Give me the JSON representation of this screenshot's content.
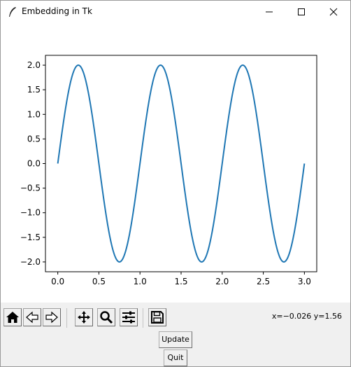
{
  "window": {
    "title": "Embedding in Tk"
  },
  "toolbar": {
    "buttons": [
      {
        "name": "home-button",
        "icon": "home-icon"
      },
      {
        "name": "back-button",
        "icon": "back-arrow-icon"
      },
      {
        "name": "forward-button",
        "icon": "forward-arrow-icon"
      },
      {
        "name": "pan-button",
        "icon": "move-icon"
      },
      {
        "name": "zoom-button",
        "icon": "magnifier-icon"
      },
      {
        "name": "subplots-button",
        "icon": "sliders-icon"
      },
      {
        "name": "save-button",
        "icon": "floppy-disk-icon"
      }
    ],
    "coords": "x=−0.026 y=1.56"
  },
  "buttons": {
    "update_label": "Update",
    "quit_label": "Quit"
  },
  "colors": {
    "line": "#1f77b4",
    "toolbar_bg": "#f0f0f0"
  },
  "chart_data": {
    "type": "line",
    "function": "y = 2*sin(2*pi*t)",
    "x_range": [
      0.0,
      3.0
    ],
    "series": [
      {
        "x": [
          0.0,
          0.1,
          0.2,
          0.25,
          0.3,
          0.4,
          0.5,
          0.6,
          0.7,
          0.75,
          0.8,
          0.9,
          1.0,
          1.1,
          1.2,
          1.25,
          1.3,
          1.4,
          1.5,
          1.6,
          1.7,
          1.75,
          1.8,
          1.9,
          2.0,
          2.1,
          2.2,
          2.25,
          2.3,
          2.4,
          2.5,
          2.6,
          2.7,
          2.75,
          2.8,
          2.9,
          3.0
        ],
        "y": [
          0.0,
          1.18,
          1.9,
          2.0,
          1.9,
          1.18,
          0.0,
          -1.18,
          -1.9,
          -2.0,
          -1.9,
          -1.18,
          0.0,
          1.18,
          1.9,
          2.0,
          1.9,
          1.18,
          0.0,
          -1.18,
          -1.9,
          -2.0,
          -1.9,
          -1.18,
          0.0,
          1.18,
          1.9,
          2.0,
          1.9,
          1.18,
          0.0,
          -1.18,
          -1.9,
          -2.0,
          -1.9,
          -1.18,
          0.0
        ]
      }
    ],
    "xticks": [
      "0.0",
      "0.5",
      "1.0",
      "1.5",
      "2.0",
      "2.5",
      "3.0"
    ],
    "yticks": [
      "2.0",
      "1.5",
      "1.0",
      "0.5",
      "0.0",
      "−0.5",
      "−1.0",
      "−1.5",
      "−2.0"
    ],
    "xlim": [
      -0.15,
      3.15
    ],
    "ylim": [
      -2.2,
      2.2
    ],
    "grid": false
  }
}
